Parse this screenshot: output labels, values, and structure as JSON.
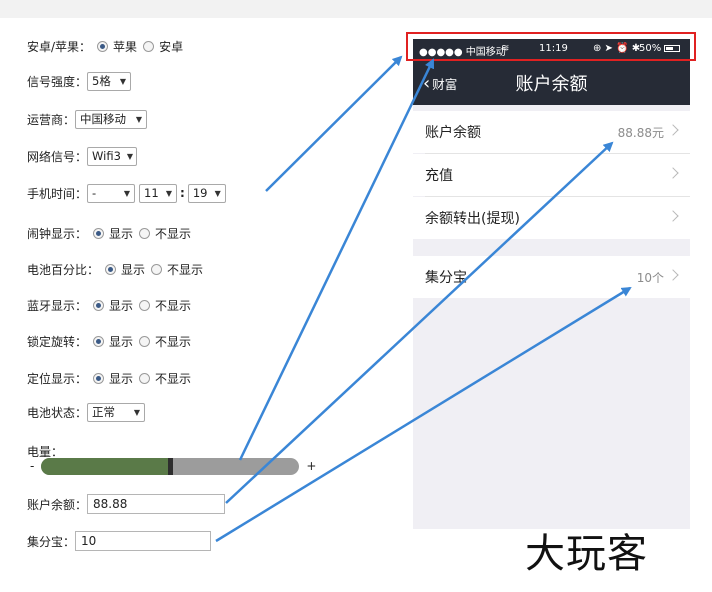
{
  "form": {
    "platform": {
      "label": "安卓/苹果：",
      "options": [
        "苹果",
        "安卓"
      ],
      "selected": 0
    },
    "signal": {
      "label": "信号强度：",
      "value": "5格"
    },
    "carrier": {
      "label": "运营商：",
      "value": "中国移动"
    },
    "network": {
      "label": "网络信号：",
      "value": "Wifi3"
    },
    "time": {
      "label": "手机时间：",
      "period": "-",
      "hour": "11",
      "minute": "19",
      "colon": ":"
    },
    "alarm": {
      "label": "闹钟显示：",
      "options": [
        "显示",
        "不显示"
      ],
      "selected": 0
    },
    "battery_percent": {
      "label": "电池百分比：",
      "options": [
        "显示",
        "不显示"
      ],
      "selected": 0
    },
    "bluetooth": {
      "label": "蓝牙显示：",
      "options": [
        "显示",
        "不显示"
      ],
      "selected": 0
    },
    "rotation_lock": {
      "label": "锁定旋转：",
      "options": [
        "显示",
        "不显示"
      ],
      "selected": 0
    },
    "location": {
      "label": "定位显示：",
      "options": [
        "显示",
        "不显示"
      ],
      "selected": 0
    },
    "battery_state": {
      "label": "电池状态：",
      "value": "正常"
    },
    "battery_level": {
      "label": "电量：",
      "minus": "-",
      "plus": "+",
      "level_fraction": 0.5
    },
    "balance": {
      "label": "账户余额：",
      "value": "88.88"
    },
    "jifenbao": {
      "label": "集分宝：",
      "value": "10"
    }
  },
  "phone": {
    "status_bar": {
      "signal": "●●●●● 中国移动",
      "time": "11:19",
      "battery": "50%"
    },
    "nav": {
      "back_label": "财富",
      "title": "账户余额"
    },
    "cells": [
      {
        "title": "账户余额",
        "value": "88.88元"
      },
      {
        "title": "充值",
        "value": ""
      },
      {
        "title": "余额转出(提现)",
        "value": ""
      },
      {
        "title": "集分宝",
        "value": "10个"
      }
    ]
  },
  "watermark": "大玩客",
  "colors": {
    "highlight": "#e02121",
    "arrow": "#3a86d6",
    "nav_bg": "#262b36",
    "battery_fill": "#5a7a48"
  }
}
